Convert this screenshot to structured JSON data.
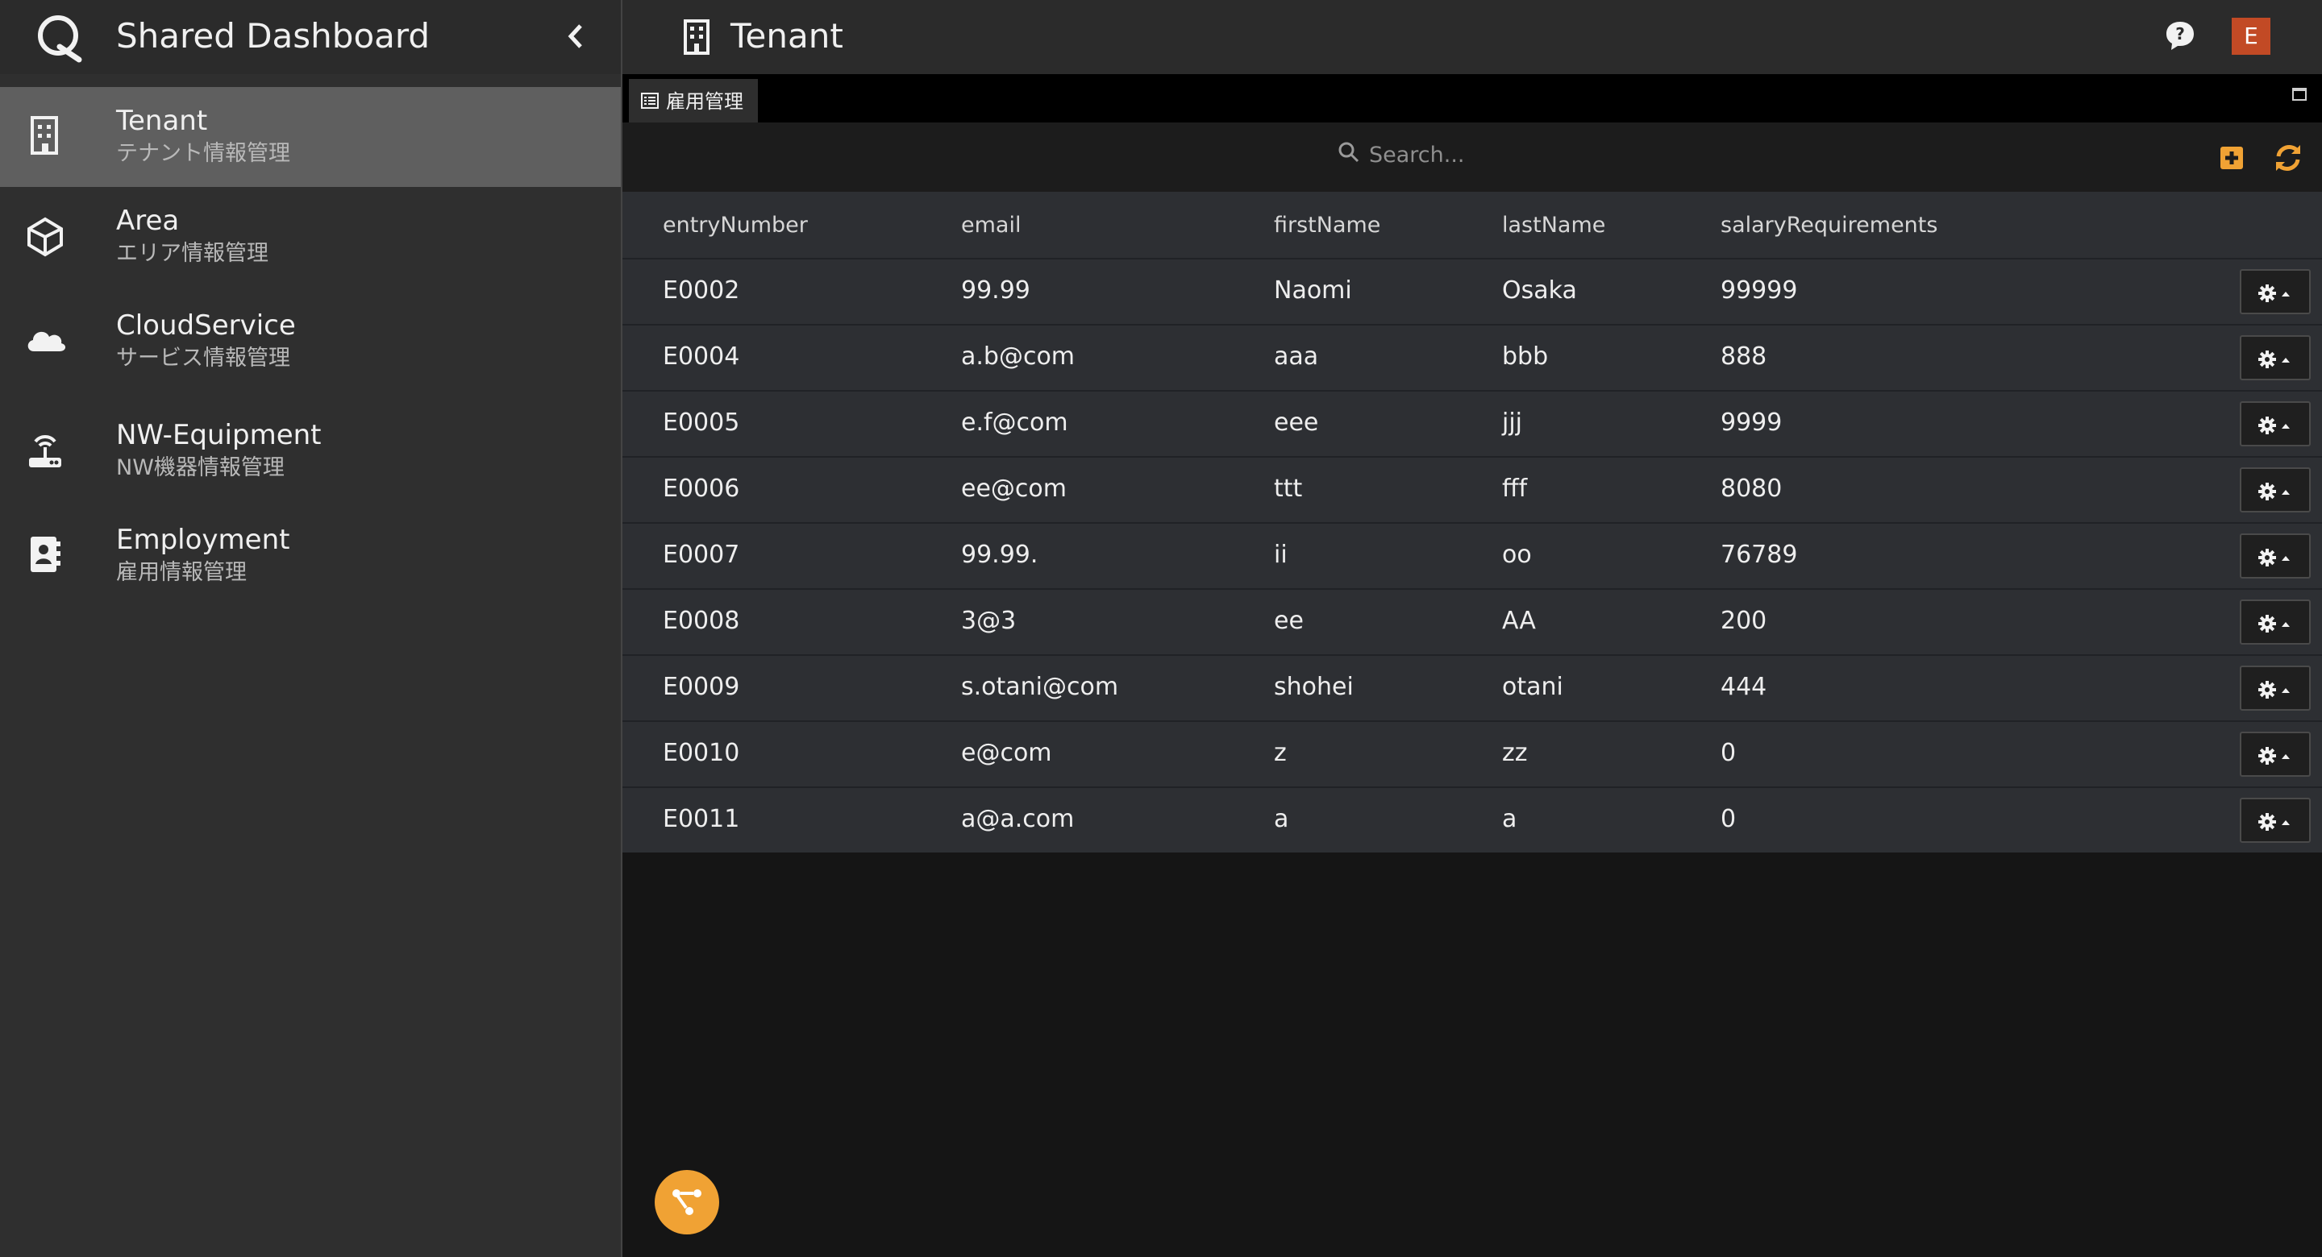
{
  "app": {
    "title": "Shared Dashboard"
  },
  "page": {
    "title": "Tenant"
  },
  "user": {
    "initial": "E"
  },
  "sidebar": {
    "items": [
      {
        "title": "Tenant",
        "subtitle": "テナント情報管理",
        "icon": "building-icon",
        "active": true
      },
      {
        "title": "Area",
        "subtitle": "エリア情報管理",
        "icon": "cube-icon",
        "active": false
      },
      {
        "title": "CloudService",
        "subtitle": "サービス情報管理",
        "icon": "cloud-icon",
        "active": false
      },
      {
        "title": "NW-Equipment",
        "subtitle": "NW機器情報管理",
        "icon": "router-icon",
        "active": false
      },
      {
        "title": "Employment",
        "subtitle": "雇用情報管理",
        "icon": "contact-book-icon",
        "active": false
      }
    ]
  },
  "tabs": [
    {
      "label": "雇用管理",
      "icon": "list-icon"
    }
  ],
  "search": {
    "placeholder": "Search..."
  },
  "table": {
    "columns": [
      "entryNumber",
      "email",
      "firstName",
      "lastName",
      "salaryRequirements"
    ],
    "rows": [
      [
        "E0002",
        "99.99",
        "Naomi",
        "Osaka",
        "99999"
      ],
      [
        "E0004",
        "a.b@com",
        "aaa",
        "bbb",
        "888"
      ],
      [
        "E0005",
        "e.f@com",
        "eee",
        "jjj",
        "9999"
      ],
      [
        "E0006",
        "ee@com",
        "ttt",
        "fff",
        "8080"
      ],
      [
        "E0007",
        "99.99.",
        "ii",
        "oo",
        "76789"
      ],
      [
        "E0008",
        "3@3",
        "ee",
        "AA",
        "200"
      ],
      [
        "E0009",
        "s.otani@com",
        "shohei",
        "otani",
        "444"
      ],
      [
        "E0010",
        "e@com",
        "z",
        "zz",
        "0"
      ],
      [
        "E0011",
        "a@a.com",
        "a",
        "a",
        "0"
      ]
    ]
  },
  "icons": {
    "collapse": "chevron-left-icon",
    "help": "help-icon",
    "add": "plus-square-icon",
    "refresh": "refresh-icon",
    "maximize": "maximize-icon",
    "row_actions": "gear-icon",
    "fab": "workflow-icon"
  },
  "colors": {
    "accent": "#f0a234",
    "avatar": "#c24a25",
    "sidebar_active": "#5f5f5f"
  }
}
